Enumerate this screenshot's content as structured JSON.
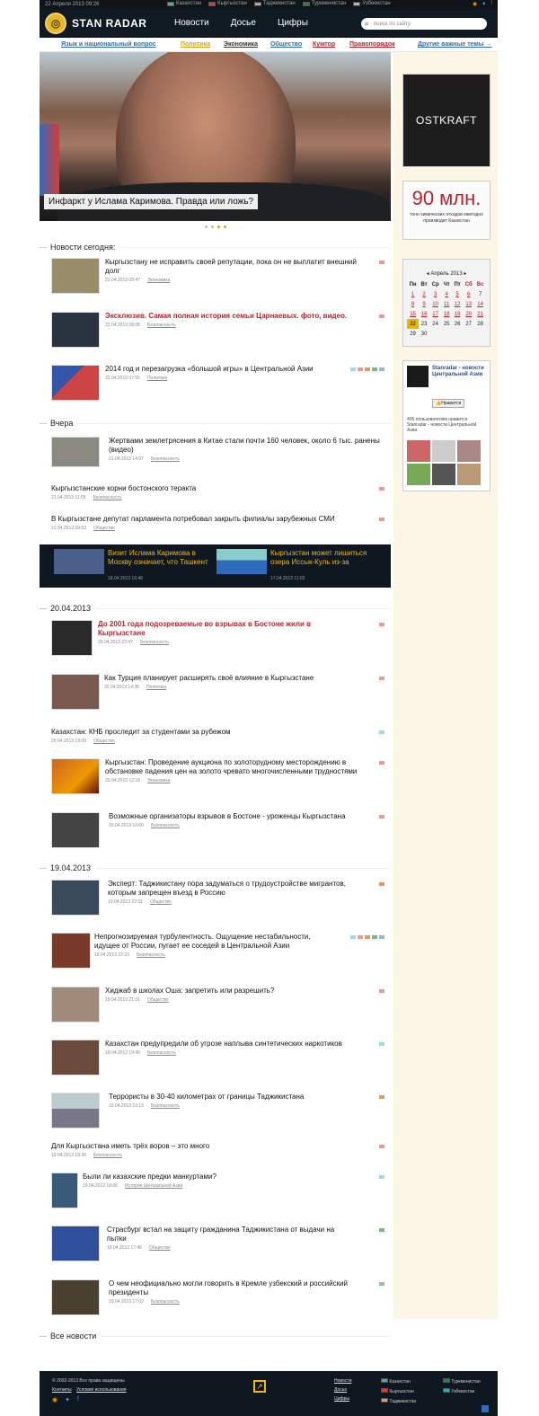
{
  "topbar": {
    "date": "22 Апреля 2013   09:26",
    "countries": [
      "Казахстан",
      "Кыргызстан",
      "Таджикистан",
      "Туркменистан",
      "Узбекистан"
    ]
  },
  "header": {
    "logo_text": "STAN RADAR",
    "nav": [
      "Новости",
      "Досье",
      "Цифры"
    ],
    "search_placeholder": "поиск по сайту"
  },
  "subnav": {
    "items": [
      "Язык и национальный вопрос",
      "Политика",
      "Экономика",
      "Общество",
      "Кумтор",
      "Правопорядок",
      "Другие важные темы →"
    ]
  },
  "slider": {
    "caption": "Инфаркт у Ислама Каримова. Правда или ложь?"
  },
  "sections": {
    "today": "Новости сегодня:",
    "yesterday": "Вчера",
    "d20": "20.04.2013",
    "d19": "19.04.2013",
    "all": "Все новости"
  },
  "today_items": [
    {
      "title": "Кыргызстану не исправить своей репутации, пока он не выплатит внешний долг",
      "date": "22.04.2013 08:47",
      "cat": "Экономика"
    },
    {
      "title": "Эксклюзив. Самая полная история семьи Царнаевых. фото, видео.",
      "date": "22.04.2013 08:08",
      "cat": "Безопасность"
    },
    {
      "title": "2014 год и перезагрузка «большой игры» в Центральной Азии",
      "date": "22.04.2013 07:55",
      "cat": "Политика"
    }
  ],
  "yesterday_items": [
    {
      "title": "Жертвами землетрясения в Китае стали почти 160 человек, около 6 тыс. ранены (видео)",
      "date": "21.04.2013 14:07",
      "cat": "Безопасность"
    },
    {
      "title": "Кыргызстанские корни бостонского теракта",
      "date": "21.04.2013 11:05",
      "cat": "Безопасность"
    },
    {
      "title": "В Кыргызстане депутат парламента потребовал закрыть филиалы зарубежных СМИ",
      "date": "21.04.2013 08:53",
      "cat": "Общество"
    }
  ],
  "promo": [
    {
      "title": "Визит Ислама Каримова в Москву означает, что Ташкент",
      "date": "18.04.2013 16:48"
    },
    {
      "title": "Кыргызстан может лишиться озера Иссык-Куль из-за",
      "date": "17.04.2013 11:02"
    }
  ],
  "d20_items": [
    {
      "title": "До 2001 года подозреваемые во взрывах в Бостоне жили в Кыргызстане",
      "date": "20.04.2013 23:47",
      "cat": "Безопасность"
    },
    {
      "title": "Как Турция планирует расширять своё влияние в Кыргызстане",
      "date": "20.04.2013 14:36",
      "cat": "Политика"
    },
    {
      "title": "Казахстан: КНБ проследит за студентами за рубежом",
      "date": "20.04.2013 13:09",
      "cat": "Общество"
    },
    {
      "title": "Кыргызстан: Проведение аукциона по золоторудному месторождению в обстановке падения цен на золото чревато многочисленными трудностями",
      "date": "20.04.2013 12:18",
      "cat": "Экономика"
    },
    {
      "title": "Возможные организаторы взрывов в Бостоне - уроженцы Кыргызстана",
      "date": "20.04.2013 10:00",
      "cat": "Безопасность"
    }
  ],
  "d19_items": [
    {
      "title": "Эксперт: Таджикистану пора задуматься о трудоустройстве мигрантов, которым запрещен въезд в Россию",
      "date": "19.04.2013 22:51",
      "cat": "Общество"
    },
    {
      "title": "Непрогнозируемая турбулентность. Ощущение нестабильности, идущее от России, пугает ее соседей в Центральной Азии",
      "date": "19.04.2013 22:23",
      "cat": "Безопасность"
    },
    {
      "title": "Хиджаб в школах Оша: запретить или разрешить?",
      "date": "19.04.2013 21:01",
      "cat": "Общество"
    },
    {
      "title": "Казахстан предупредили об угрозе наплыва синтетических наркотиков",
      "date": "19.04.2013 19:49",
      "cat": "Безопасность"
    },
    {
      "title": "Террористы в 30-40 километрах от границы Таджикистана",
      "date": "19.04.2013 19:13",
      "cat": "Безопасность"
    },
    {
      "title": "Для Кыргызстана иметь трёх воров – это много",
      "date": "19.04.2013 18:39",
      "cat": "Безопасность"
    },
    {
      "title": "Были ли казахские предки манкуртами?",
      "date": "19.04.2013 18:06",
      "cat": "История Центральной Азии"
    },
    {
      "title": "Страсбург встал на защиту гражданина Таджикистана от выдачи на пытки",
      "date": "19.04.2013 17:46",
      "cat": "Общество"
    },
    {
      "title": "О чем неофициально могли говорить в Кремле узбекский и российский президенты",
      "date": "19.04.2013 17:02",
      "cat": "Безопасность"
    }
  ],
  "sidebar": {
    "ostkraft": "OSTKRAFT",
    "mln_big": "90 млн.",
    "mln_small": "тонн химических отходов ежегодно производит Казахстан",
    "cal_month": "Апрель 2013",
    "cal_weekdays": [
      "Пн",
      "Вт",
      "Ср",
      "Чт",
      "Пт",
      "Сб",
      "Вс"
    ],
    "fb_name": "Stanradar - новости Центральной Азии",
    "fb_like": "Нравится",
    "fb_text": "405 пользователям нравится Stanradar - новости Центральной Азии."
  },
  "footer": {
    "copyright": "© 2002-2013 Все права защищены",
    "links": [
      "Контакты",
      "Условия использования"
    ],
    "col2": [
      "Новости",
      "Досье",
      "Цифры"
    ],
    "col3": [
      "Казахстан",
      "Кыргызстан",
      "Таджикистан"
    ],
    "col4": [
      "Туркменистан",
      "Узбекистан"
    ]
  },
  "colors": {
    "accent": "#f4b800",
    "header": "#0f1a22",
    "red": "#c0202a",
    "sidebar": "#fdf6e7"
  }
}
